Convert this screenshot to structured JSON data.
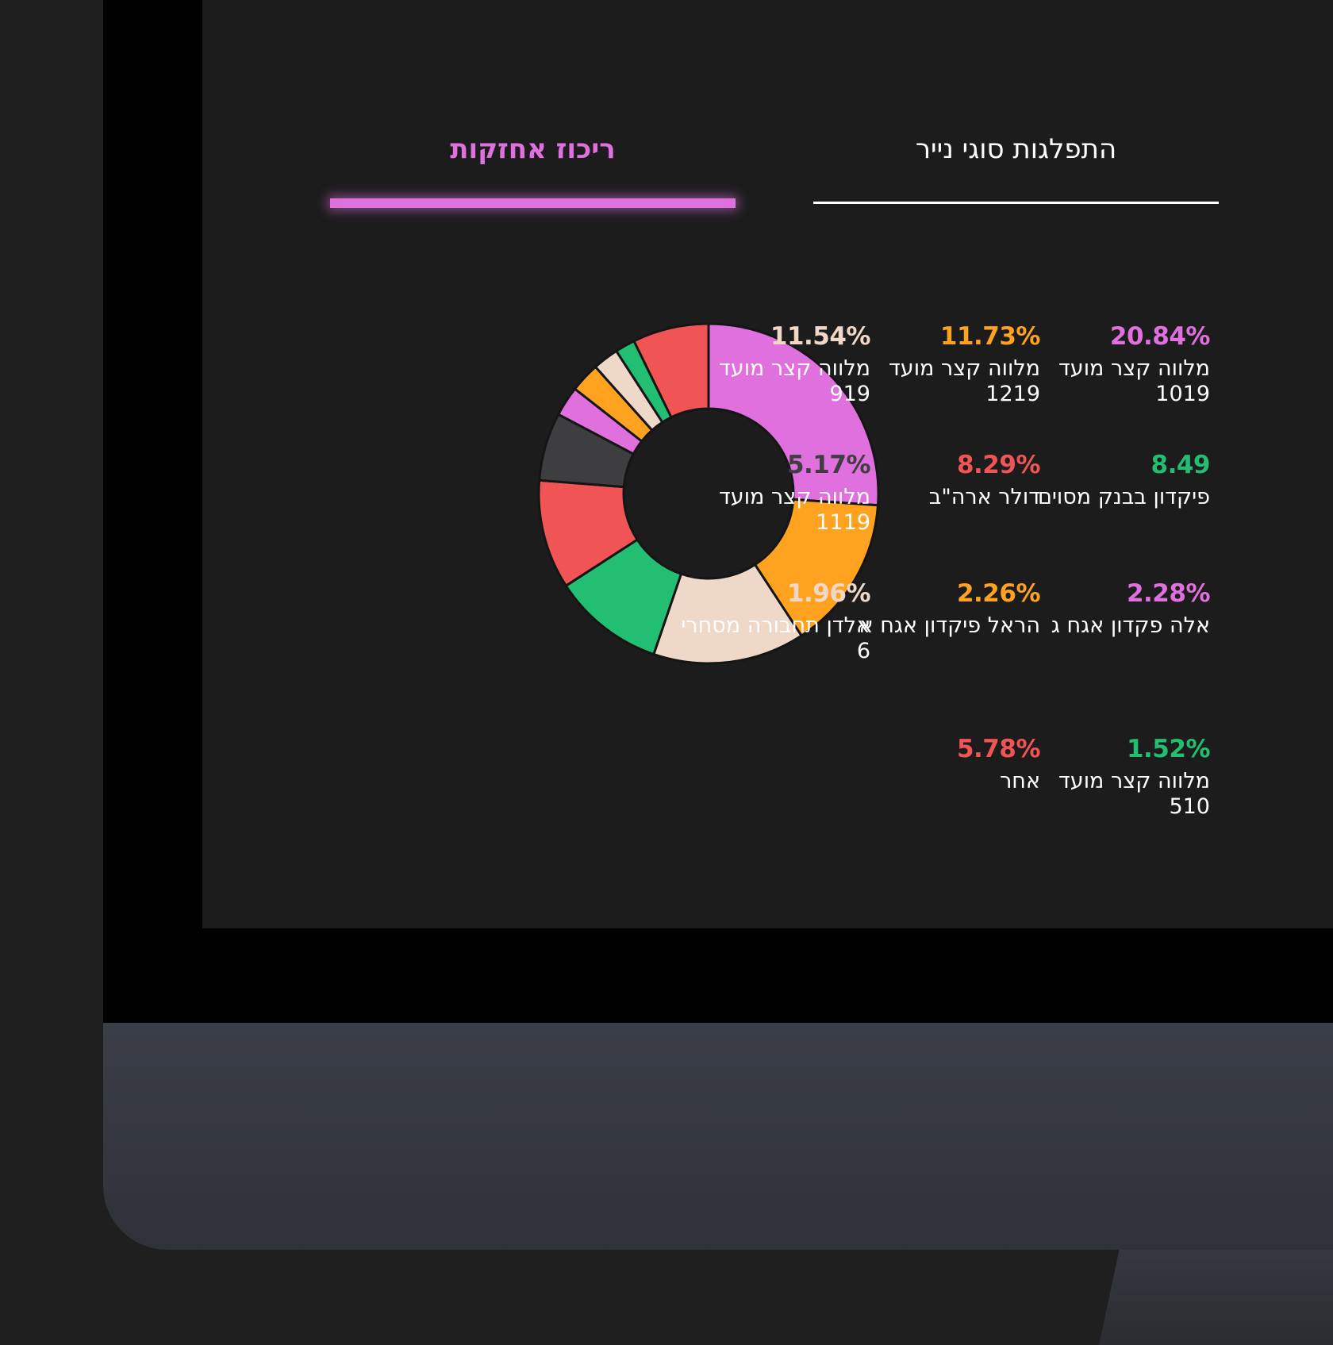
{
  "tabs": [
    {
      "label": "התפלגות סוגי נייר",
      "active": false
    },
    {
      "label": "ריכוז אחזקות",
      "active": true
    }
  ],
  "colors": {
    "accent": "#e070dd",
    "pink": "#e070dd",
    "orange": "#ffa21f",
    "cream": "#f0d8c8",
    "green": "#22bf73",
    "red": "#f05454",
    "gray": "#3e3e40"
  },
  "legend": [
    {
      "value": "20.84%",
      "label": "מלווה קצר מועד 1019",
      "color": "#e070dd"
    },
    {
      "value": "11.73%",
      "label": "מלווה קצר מועד 1219",
      "color": "#ffa21f"
    },
    {
      "value": "11.54%",
      "label": "מלווה קצר מועד 919",
      "color": "#f0d8c8"
    },
    {
      "value": "8.49",
      "label": "פיקדון בבנק מסוים",
      "color": "#22bf73"
    },
    {
      "value": "8.29%",
      "label": "דולר ארה\"ב",
      "color": "#f05454"
    },
    {
      "value": "5.17%",
      "label": "מלווה קצר מועד 1119",
      "color": "#3e3e40"
    },
    {
      "value": "2.28%",
      "label": "אלה פקדון אגח ג",
      "color": "#e070dd"
    },
    {
      "value": "2.26%",
      "label": "הראל פיקדון אגח א",
      "color": "#ffa21f"
    },
    {
      "value": "1.96%",
      "label": "אלדן תחבורה מסחרי 6",
      "color": "#f0d8c8"
    },
    {
      "value": "1.52%",
      "label": "מלווה קצר מועד 510",
      "color": "#22bf73"
    },
    {
      "value": "5.78%",
      "label": "אחר",
      "color": "#f05454"
    }
  ],
  "chart_data": {
    "type": "pie",
    "donut": true,
    "categories": [
      "מלווה קצר מועד 1019",
      "מלווה קצר מועד 1219",
      "מלווה קצר מועד 919",
      "פיקדון בבנק מסוים",
      "דולר ארה\"ב",
      "מלווה קצר מועד 1119",
      "אלה פקדון אגח ג",
      "הראל פיקדון אגח א",
      "אלדן תחבורה מסחרי 6",
      "מלווה קצר מועד 510",
      "אחר"
    ],
    "values": [
      20.84,
      11.73,
      11.54,
      8.49,
      8.29,
      5.17,
      2.28,
      2.26,
      1.96,
      1.52,
      5.78
    ],
    "colors": [
      "#e070dd",
      "#ffa21f",
      "#f0d8c8",
      "#22bf73",
      "#f05454",
      "#3e3e40",
      "#e070dd",
      "#ffa21f",
      "#f0d8c8",
      "#22bf73",
      "#f05454"
    ]
  }
}
